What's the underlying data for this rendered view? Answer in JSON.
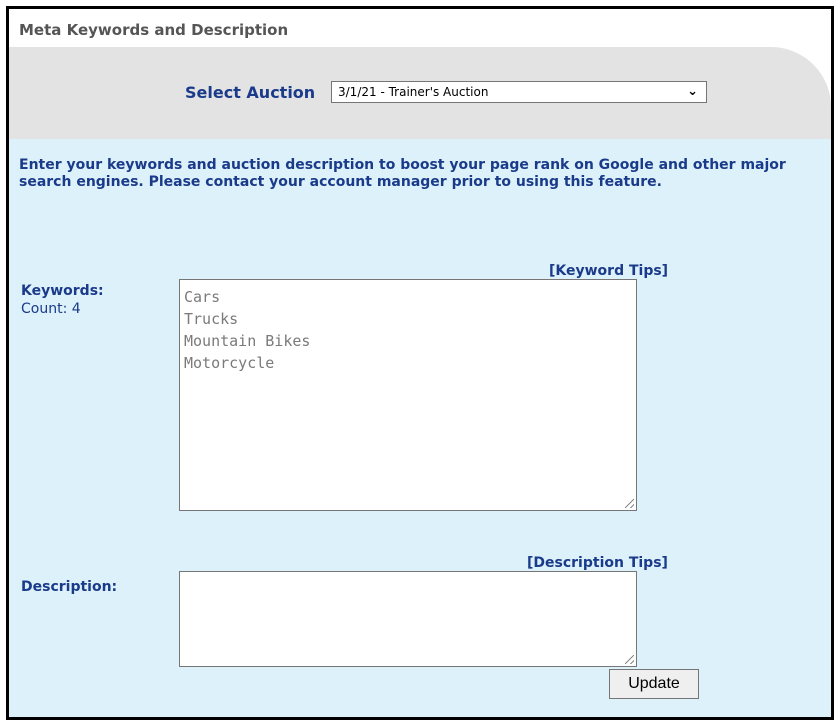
{
  "panel": {
    "title": "Meta Keywords and Description"
  },
  "auction": {
    "label": "Select Auction",
    "selected": "3/1/21 - Trainer's Auction",
    "chevron_icon": "chevron-down-icon"
  },
  "intro": "Enter your keywords and auction description to boost your page rank on Google and other major search engines. Please contact your account manager prior to using this feature.",
  "keywords": {
    "tips_link": "[Keyword Tips]",
    "label": "Keywords:",
    "count_label": "Count:",
    "count": "4",
    "items": [
      "Cars",
      "Trucks",
      "Mountain Bikes",
      "Motorcycle"
    ]
  },
  "description": {
    "tips_link": "[Description Tips]",
    "label": "Description:",
    "value": ""
  },
  "update_button": "Update",
  "colors": {
    "label_blue": "#1a3a8a",
    "content_background": "#ddf1fb",
    "header_gray": "#e3e3e3"
  }
}
